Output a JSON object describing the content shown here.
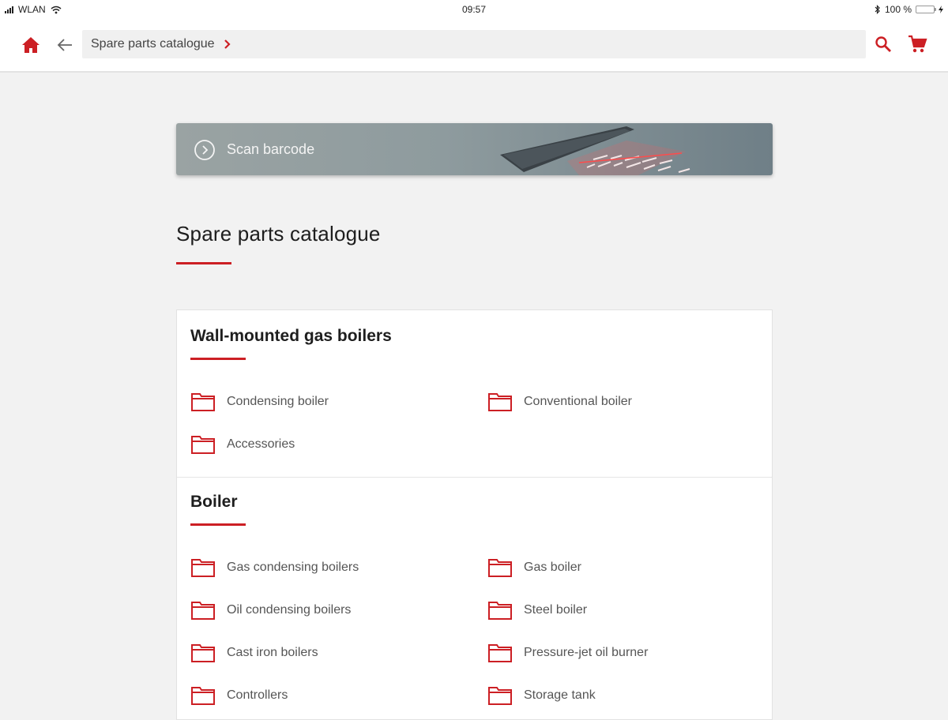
{
  "status_bar": {
    "carrier": "WLAN",
    "time": "09:57",
    "battery": "100 %"
  },
  "header": {
    "breadcrumb": "Spare parts catalogue",
    "icons": [
      "home-icon",
      "back-arrow-icon",
      "chevron-right-icon",
      "search-icon",
      "cart-icon"
    ],
    "accent_color": "#cc1f24"
  },
  "scan": {
    "label": "Scan barcode"
  },
  "page": {
    "title": "Spare parts catalogue"
  },
  "sections": [
    {
      "title": "Wall-mounted gas boilers",
      "items": [
        "Condensing boiler",
        "Conventional boiler",
        "Accessories"
      ]
    },
    {
      "title": "Boiler",
      "items": [
        "Gas condensing boilers",
        "Gas boiler",
        "Oil condensing boilers",
        "Steel boiler",
        "Cast iron boilers",
        "Pressure-jet oil burner",
        "Controllers",
        "Storage tank"
      ]
    }
  ]
}
